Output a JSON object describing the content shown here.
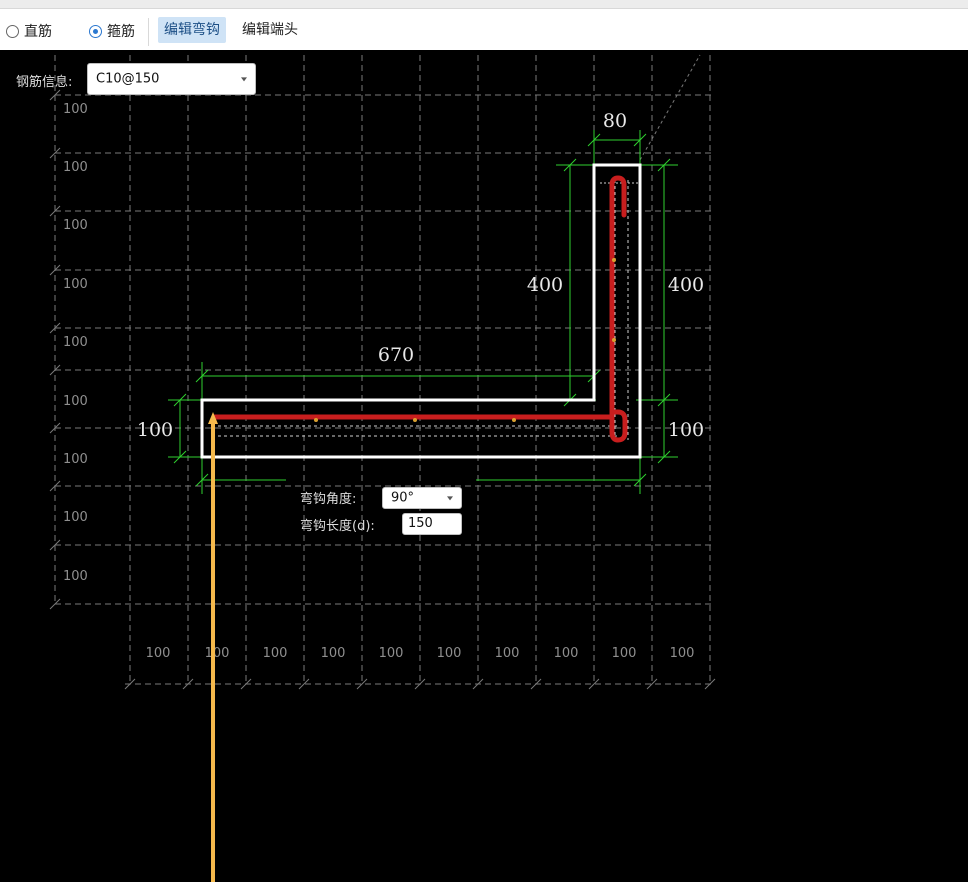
{
  "toolbar": {
    "radio_straight": "直筋",
    "radio_stirrup": "箍筋",
    "selected": "stirrup",
    "edit_hook": "编辑弯钩",
    "edit_end": "编辑端头"
  },
  "rebar_info": {
    "label": "钢筋信息:",
    "value": "C10@150"
  },
  "hook": {
    "angle_label": "弯钩角度:",
    "angle_value": "90°",
    "length_label": "弯钩长度(d):",
    "length_value": "150"
  },
  "dimensions": {
    "top_width": "80",
    "inner_height": "400",
    "outer_height": "400",
    "horizontal_length": "670",
    "left_height": "100",
    "right_height": "100"
  },
  "grid": {
    "spacing_label": "100"
  },
  "colors": {
    "background": "#000000",
    "grid": "#8a8a8a",
    "dimension": "#33d933",
    "outline": "#ffffff",
    "rebar": "#cc1f1f",
    "pointer": "#f5b94c",
    "active_button": "#cfe3f6"
  }
}
